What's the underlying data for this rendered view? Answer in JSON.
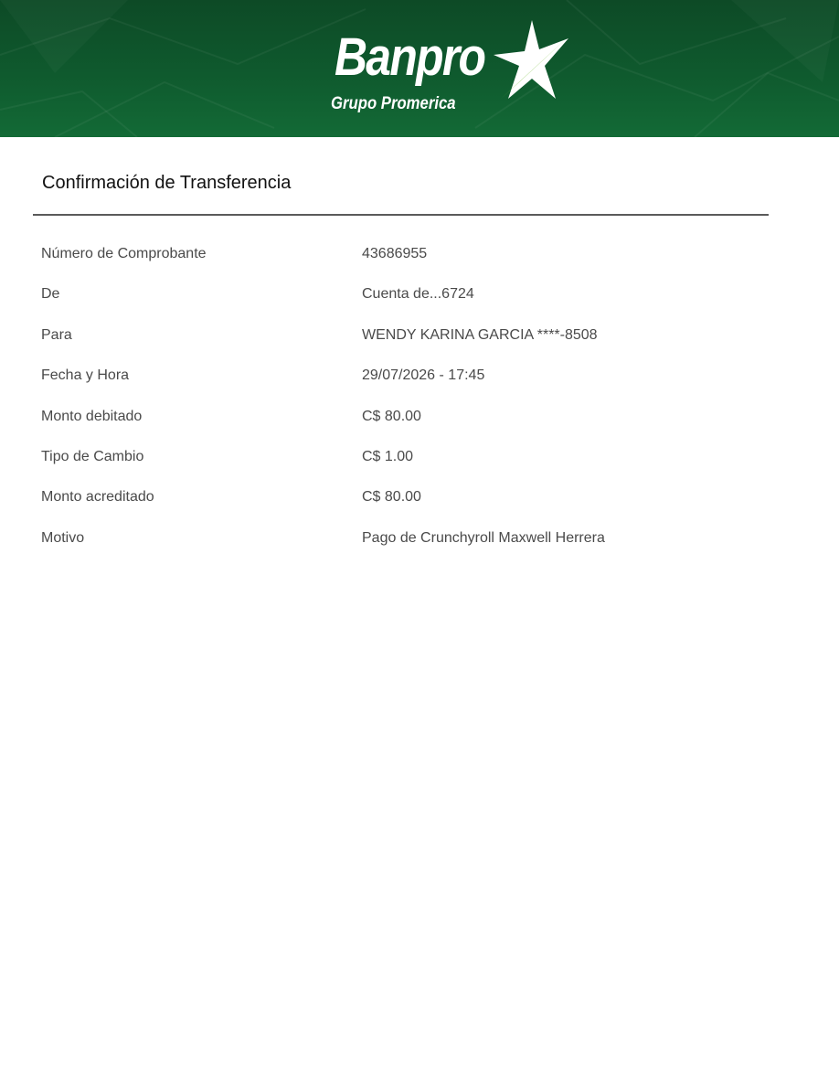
{
  "brand": {
    "name": "Banpro",
    "subtitle": "Grupo Promerica",
    "colors": {
      "header_green": "#0f5a2e",
      "star_light_green": "#7cc242",
      "white": "#ffffff"
    },
    "icon": "star-logo-icon"
  },
  "page": {
    "title": "Confirmación de Transferencia"
  },
  "details": [
    {
      "label": "Número de Comprobante",
      "value": "43686955"
    },
    {
      "label": "De",
      "value": "Cuenta de...6724"
    },
    {
      "label": "Para",
      "value": "WENDY KARINA GARCIA ****-8508"
    },
    {
      "label": "Fecha y Hora",
      "value": "29/07/2026 - 17:45"
    },
    {
      "label": "Monto debitado",
      "value": "C$ 80.00"
    },
    {
      "label": "Tipo de Cambio",
      "value": "C$ 1.00"
    },
    {
      "label": "Monto acreditado",
      "value": "C$ 80.00"
    },
    {
      "label": "Motivo",
      "value": "Pago de Crunchyroll Maxwell Herrera"
    }
  ]
}
